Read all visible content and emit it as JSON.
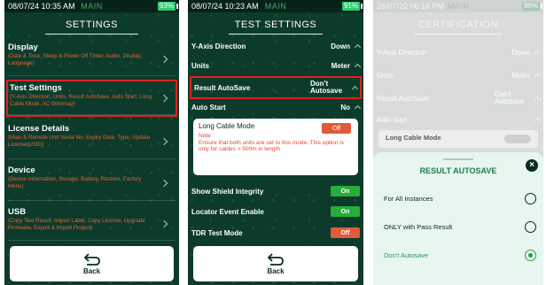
{
  "screen1": {
    "status": {
      "time": "08/07/24 10:35 AM",
      "mode": "MAIN",
      "battery": "93%"
    },
    "title": "SETTINGS",
    "items": [
      {
        "label": "Display",
        "desc": "(Date & Time, Sleep & Power Off Timer, Audio, Display, Language)"
      },
      {
        "label": "Test Settings",
        "desc": "(Y-Axis Direction, Units, Result AutoSave, Auto Start, Long Cable Mode, AC Wiremap)"
      },
      {
        "label": "License Details",
        "desc": "(Main & Remote Unit Serial No, Expiry Date, Type, Update License(USB))"
      },
      {
        "label": "Device",
        "desc": "(Device Information, Storage, Battery, Restore, Factory Menu)"
      },
      {
        "label": "USB",
        "desc": "(Copy Test Result, Import Label, Copy License, Upgrade Firmware, Export & Import Project)"
      }
    ],
    "back": "Back"
  },
  "screen2": {
    "status": {
      "time": "08/07/24 10:23 AM",
      "mode": "MAIN",
      "battery": "91%"
    },
    "title": "TEST SETTINGS",
    "rows": [
      {
        "label": "Y-Axis Direction",
        "value": "Down"
      },
      {
        "label": "Units",
        "value": "Meter"
      },
      {
        "label": "Result AutoSave",
        "value": "Don't Autosave"
      },
      {
        "label": "Auto Start",
        "value": "No"
      }
    ],
    "long_cable": {
      "label": "Long Cable Mode",
      "state": "Off",
      "note_title": "Note:",
      "note": "Ensure that both units are set to this mode. This option is only for cables > 500m in length"
    },
    "toggles": [
      {
        "label": "Show Shield Integrity",
        "state": "On"
      },
      {
        "label": "Locator Event Enable",
        "state": "On"
      },
      {
        "label": "TDR Test Mode",
        "state": "Off"
      }
    ],
    "back": "Back"
  },
  "screen3": {
    "status": {
      "time": "26/07/22 06:16 PM",
      "mode": "MAIN",
      "battery": "86%"
    },
    "title": "CERTIFICATION",
    "rows": [
      {
        "label": "Y-Axis Direction",
        "value": "Down"
      },
      {
        "label": "Units",
        "value": "Meter"
      },
      {
        "label": "Result AutoSave",
        "value": "Don't Autosave"
      },
      {
        "label": "Auto start",
        "value": ""
      }
    ],
    "long_cable": "Long Cable Mode",
    "sheet": {
      "title": "RESULT AUTOSAVE",
      "options": [
        "For All Instances",
        "ONLY with Pass Result",
        "Don't Autosave"
      ]
    }
  },
  "colors": {
    "bg": "#0c3b2c",
    "accent": "#2ecc71",
    "warn": "#e05a3b",
    "highlight": "#e02020"
  }
}
